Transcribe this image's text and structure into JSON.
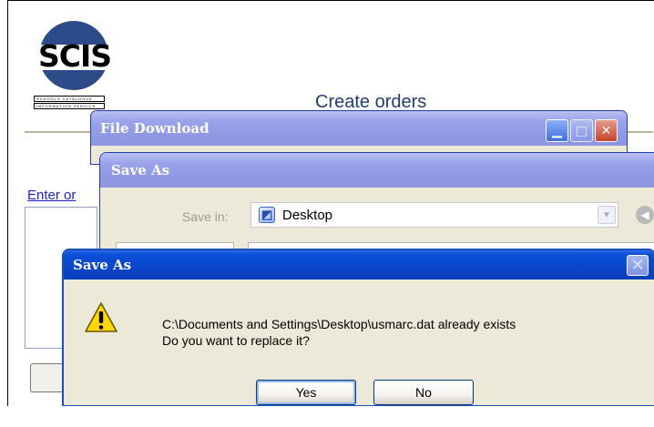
{
  "page": {
    "logo_text": "SCIS",
    "logo_lines": [
      "SCHOOLS CATALOGUE",
      "INFORMATION SERVICE"
    ],
    "title": "Create orders",
    "link_text": "Enter or"
  },
  "file_download": {
    "title": "File Download"
  },
  "save_as_window": {
    "title": "Save As",
    "save_in_label": "Save in:",
    "save_in_value": "Desktop"
  },
  "confirm_dialog": {
    "title": "Save As",
    "message_line1": "C:\\Documents and Settings\\Desktop\\usmarc.dat already exists",
    "message_line2": "Do you want to replace it?",
    "yes_label": "Yes",
    "no_label": "No"
  },
  "colors": {
    "xp_title_blue": "#0a4fd8",
    "logo_blue": "#2d4b88",
    "link_blue": "#2020cc",
    "dialog_face": "#ece9d8"
  },
  "icons": [
    "warning-icon",
    "desktop-folder-icon",
    "back-arrow-icon",
    "minimize-icon",
    "maximize-icon",
    "close-icon"
  ]
}
